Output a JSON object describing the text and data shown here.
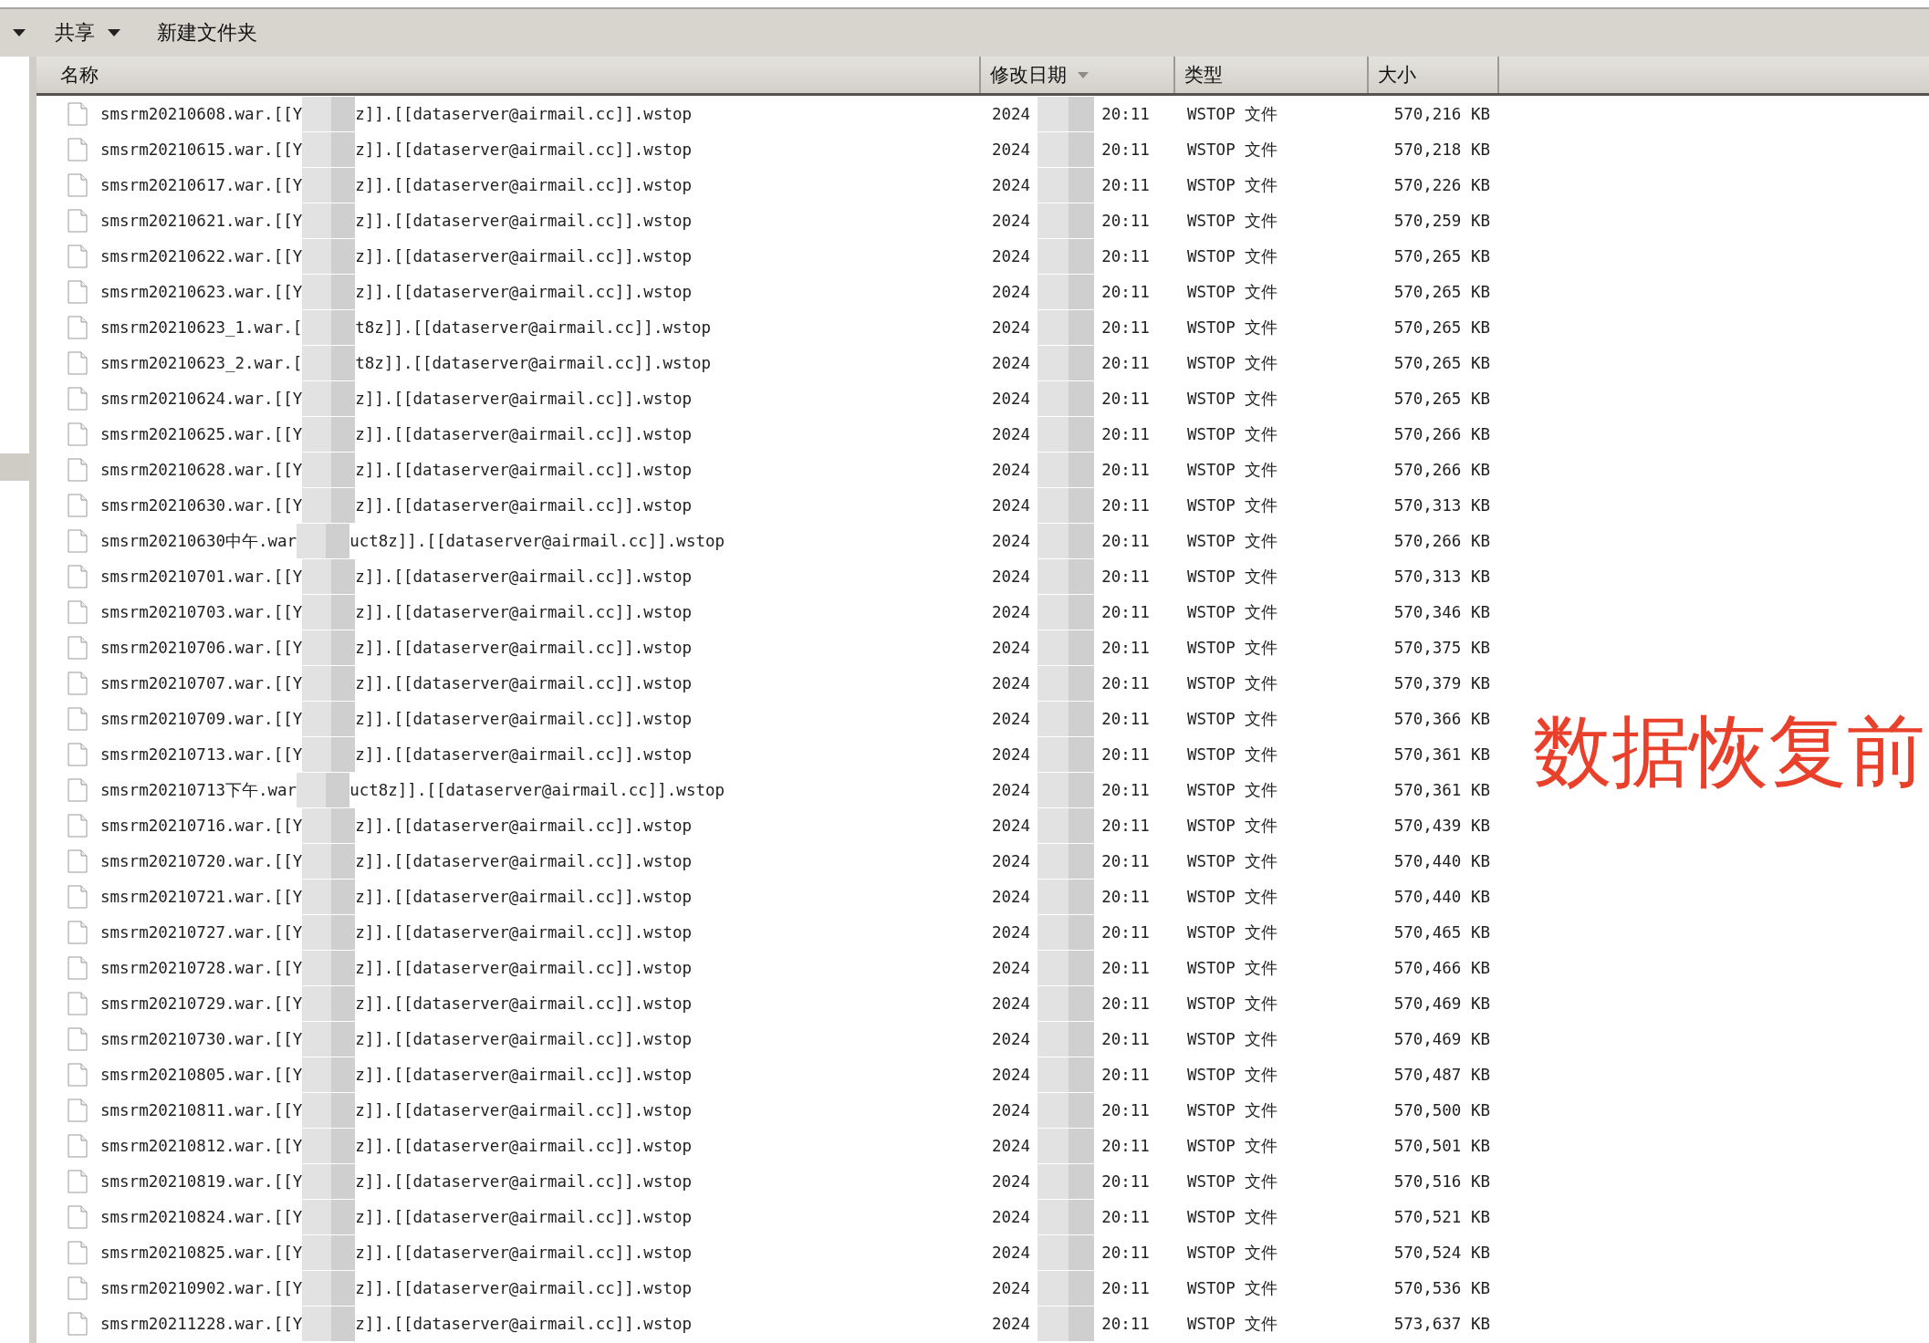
{
  "toolbar": {
    "items": [
      {
        "kind": "caret"
      },
      {
        "kind": "menu",
        "label": "共享"
      },
      {
        "kind": "button",
        "label": "新建文件夹"
      }
    ]
  },
  "table": {
    "columns": [
      {
        "label": "名称",
        "sorted": false
      },
      {
        "label": "修改日期",
        "sorted": true
      },
      {
        "label": "类型",
        "sorted": false
      },
      {
        "label": "大小",
        "sorted": false
      }
    ],
    "rows": [
      {
        "name_start": "smsrm20210608.war.[[Y",
        "name_end": "z]].[[dataserver@airmail.cc]].wstop",
        "date": "2024",
        "time": "20:11",
        "type": "WSTOP 文件",
        "size": "570,216 KB"
      },
      {
        "name_start": "smsrm20210615.war.[[Y",
        "name_end": "z]].[[dataserver@airmail.cc]].wstop",
        "date": "2024",
        "time": "20:11",
        "type": "WSTOP 文件",
        "size": "570,218 KB"
      },
      {
        "name_start": "smsrm20210617.war.[[Y",
        "name_end": "z]].[[dataserver@airmail.cc]].wstop",
        "date": "2024",
        "time": "20:11",
        "type": "WSTOP 文件",
        "size": "570,226 KB"
      },
      {
        "name_start": "smsrm20210621.war.[[Y",
        "name_end": "z]].[[dataserver@airmail.cc]].wstop",
        "date": "2024",
        "time": "20:11",
        "type": "WSTOP 文件",
        "size": "570,259 KB"
      },
      {
        "name_start": "smsrm20210622.war.[[Y",
        "name_end": "z]].[[dataserver@airmail.cc]].wstop",
        "date": "2024",
        "time": "20:11",
        "type": "WSTOP 文件",
        "size": "570,265 KB"
      },
      {
        "name_start": "smsrm20210623.war.[[Y",
        "name_end": "z]].[[dataserver@airmail.cc]].wstop",
        "date": "2024",
        "time": "20:11",
        "type": "WSTOP 文件",
        "size": "570,265 KB"
      },
      {
        "name_start": "smsrm20210623_1.war.[",
        "name_end": "t8z]].[[dataserver@airmail.cc]].wstop",
        "date": "2024",
        "time": "20:11",
        "type": "WSTOP 文件",
        "size": "570,265 KB"
      },
      {
        "name_start": "smsrm20210623_2.war.[",
        "name_end": "t8z]].[[dataserver@airmail.cc]].wstop",
        "date": "2024",
        "time": "20:11",
        "type": "WSTOP 文件",
        "size": "570,265 KB"
      },
      {
        "name_start": "smsrm20210624.war.[[Y",
        "name_end": "z]].[[dataserver@airmail.cc]].wstop",
        "date": "2024",
        "time": "20:11",
        "type": "WSTOP 文件",
        "size": "570,265 KB"
      },
      {
        "name_start": "smsrm20210625.war.[[Y",
        "name_end": "z]].[[dataserver@airmail.cc]].wstop",
        "date": "2024",
        "time": "20:11",
        "type": "WSTOP 文件",
        "size": "570,266 KB"
      },
      {
        "name_start": "smsrm20210628.war.[[Y",
        "name_end": "z]].[[dataserver@airmail.cc]].wstop",
        "date": "2024",
        "time": "20:11",
        "type": "WSTOP 文件",
        "size": "570,266 KB"
      },
      {
        "name_start": "smsrm20210630.war.[[Y",
        "name_end": "z]].[[dataserver@airmail.cc]].wstop",
        "date": "2024",
        "time": "20:11",
        "type": "WSTOP 文件",
        "size": "570,313 KB"
      },
      {
        "name_start": "smsrm20210630中午.war",
        "name_end": "uct8z]].[[dataserver@airmail.cc]].wstop",
        "date": "2024",
        "time": "20:11",
        "type": "WSTOP 文件",
        "size": "570,266 KB"
      },
      {
        "name_start": "smsrm20210701.war.[[Y",
        "name_end": "z]].[[dataserver@airmail.cc]].wstop",
        "date": "2024",
        "time": "20:11",
        "type": "WSTOP 文件",
        "size": "570,313 KB"
      },
      {
        "name_start": "smsrm20210703.war.[[Y",
        "name_end": "z]].[[dataserver@airmail.cc]].wstop",
        "date": "2024",
        "time": "20:11",
        "type": "WSTOP 文件",
        "size": "570,346 KB"
      },
      {
        "name_start": "smsrm20210706.war.[[Y",
        "name_end": "z]].[[dataserver@airmail.cc]].wstop",
        "date": "2024",
        "time": "20:11",
        "type": "WSTOP 文件",
        "size": "570,375 KB"
      },
      {
        "name_start": "smsrm20210707.war.[[Y",
        "name_end": "z]].[[dataserver@airmail.cc]].wstop",
        "date": "2024",
        "time": "20:11",
        "type": "WSTOP 文件",
        "size": "570,379 KB"
      },
      {
        "name_start": "smsrm20210709.war.[[Y",
        "name_end": "z]].[[dataserver@airmail.cc]].wstop",
        "date": "2024",
        "time": "20:11",
        "type": "WSTOP 文件",
        "size": "570,366 KB"
      },
      {
        "name_start": "smsrm20210713.war.[[Y",
        "name_end": "z]].[[dataserver@airmail.cc]].wstop",
        "date": "2024",
        "time": "20:11",
        "type": "WSTOP 文件",
        "size": "570,361 KB"
      },
      {
        "name_start": "smsrm20210713下午.war",
        "name_end": "uct8z]].[[dataserver@airmail.cc]].wstop",
        "date": "2024",
        "time": "20:11",
        "type": "WSTOP 文件",
        "size": "570,361 KB"
      },
      {
        "name_start": "smsrm20210716.war.[[Y",
        "name_end": "z]].[[dataserver@airmail.cc]].wstop",
        "date": "2024",
        "time": "20:11",
        "type": "WSTOP 文件",
        "size": "570,439 KB"
      },
      {
        "name_start": "smsrm20210720.war.[[Y",
        "name_end": "z]].[[dataserver@airmail.cc]].wstop",
        "date": "2024",
        "time": "20:11",
        "type": "WSTOP 文件",
        "size": "570,440 KB"
      },
      {
        "name_start": "smsrm20210721.war.[[Y",
        "name_end": "z]].[[dataserver@airmail.cc]].wstop",
        "date": "2024",
        "time": "20:11",
        "type": "WSTOP 文件",
        "size": "570,440 KB"
      },
      {
        "name_start": "smsrm20210727.war.[[Y",
        "name_end": "z]].[[dataserver@airmail.cc]].wstop",
        "date": "2024",
        "time": "20:11",
        "type": "WSTOP 文件",
        "size": "570,465 KB"
      },
      {
        "name_start": "smsrm20210728.war.[[Y",
        "name_end": "z]].[[dataserver@airmail.cc]].wstop",
        "date": "2024",
        "time": "20:11",
        "type": "WSTOP 文件",
        "size": "570,466 KB"
      },
      {
        "name_start": "smsrm20210729.war.[[Y",
        "name_end": "z]].[[dataserver@airmail.cc]].wstop",
        "date": "2024",
        "time": "20:11",
        "type": "WSTOP 文件",
        "size": "570,469 KB"
      },
      {
        "name_start": "smsrm20210730.war.[[Y",
        "name_end": "z]].[[dataserver@airmail.cc]].wstop",
        "date": "2024",
        "time": "20:11",
        "type": "WSTOP 文件",
        "size": "570,469 KB"
      },
      {
        "name_start": "smsrm20210805.war.[[Y",
        "name_end": "z]].[[dataserver@airmail.cc]].wstop",
        "date": "2024",
        "time": "20:11",
        "type": "WSTOP 文件",
        "size": "570,487 KB"
      },
      {
        "name_start": "smsrm20210811.war.[[Y",
        "name_end": "z]].[[dataserver@airmail.cc]].wstop",
        "date": "2024",
        "time": "20:11",
        "type": "WSTOP 文件",
        "size": "570,500 KB"
      },
      {
        "name_start": "smsrm20210812.war.[[Y",
        "name_end": "z]].[[dataserver@airmail.cc]].wstop",
        "date": "2024",
        "time": "20:11",
        "type": "WSTOP 文件",
        "size": "570,501 KB"
      },
      {
        "name_start": "smsrm20210819.war.[[Y",
        "name_end": "z]].[[dataserver@airmail.cc]].wstop",
        "date": "2024",
        "time": "20:11",
        "type": "WSTOP 文件",
        "size": "570,516 KB"
      },
      {
        "name_start": "smsrm20210824.war.[[Y",
        "name_end": "z]].[[dataserver@airmail.cc]].wstop",
        "date": "2024",
        "time": "20:11",
        "type": "WSTOP 文件",
        "size": "570,521 KB"
      },
      {
        "name_start": "smsrm20210825.war.[[Y",
        "name_end": "z]].[[dataserver@airmail.cc]].wstop",
        "date": "2024",
        "time": "20:11",
        "type": "WSTOP 文件",
        "size": "570,524 KB"
      },
      {
        "name_start": "smsrm20210902.war.[[Y",
        "name_end": "z]].[[dataserver@airmail.cc]].wstop",
        "date": "2024",
        "time": "20:11",
        "type": "WSTOP 文件",
        "size": "570,536 KB"
      },
      {
        "name_start": "smsrm20211228.war.[[Y",
        "name_end": "z]].[[dataserver@airmail.cc]].wstop",
        "date": "2024",
        "time": "20:11",
        "type": "WSTOP 文件",
        "size": "573,637 KB"
      }
    ]
  },
  "annotation": "数据恢复前"
}
